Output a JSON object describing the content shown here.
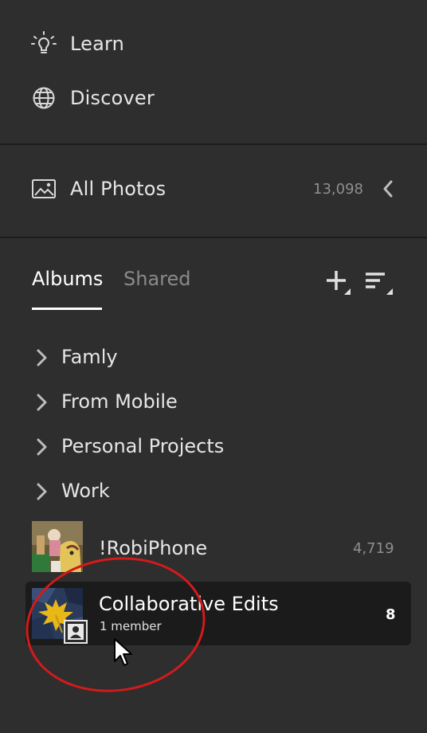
{
  "nav": {
    "learn_label": "Learn",
    "discover_label": "Discover"
  },
  "all_photos": {
    "label": "All Photos",
    "count": "13,098"
  },
  "tabs": {
    "albums_label": "Albums",
    "shared_label": "Shared"
  },
  "folders": [
    {
      "label": "Famly"
    },
    {
      "label": "From Mobile"
    },
    {
      "label": "Personal Projects"
    },
    {
      "label": "Work"
    }
  ],
  "albums": [
    {
      "label": "!RobiPhone",
      "count": "4,719"
    },
    {
      "label": "Collaborative Edits",
      "subtitle": "1 member",
      "count": "8"
    }
  ],
  "colors": {
    "background": "#2e2e2e",
    "selected_row": "#1b1b1b",
    "annotation": "#d41a1a"
  },
  "icons": [
    "lightbulb-icon",
    "globe-icon",
    "photo-icon",
    "chevron-left-icon",
    "add-icon",
    "sort-icon",
    "chevron-right-icon",
    "member-icon",
    "cursor-icon"
  ]
}
